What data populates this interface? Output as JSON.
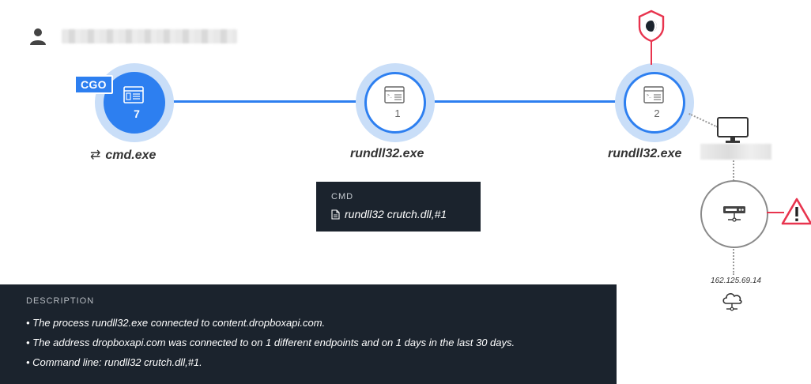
{
  "user": {
    "icon": "user-icon",
    "name_blurred": true
  },
  "nodes": [
    {
      "id": "cmd",
      "label": "cmd.exe",
      "count": "7",
      "badge": "CGO",
      "icon": "window-icon",
      "active": true,
      "prefix_icon": "sync-icon"
    },
    {
      "id": "rundll1",
      "label": "rundll32.exe",
      "count": "1",
      "icon": "window-icon",
      "active": false
    },
    {
      "id": "rundll2",
      "label": "rundll32.exe",
      "count": "2",
      "icon": "window-icon",
      "active": false
    }
  ],
  "cmd_tooltip": {
    "title": "CMD",
    "value": "rundll32 crutch.dll,#1",
    "icon": "file-icon"
  },
  "description": {
    "title": "DESCRIPTION",
    "items": [
      "• The process rundll32.exe connected to content.dropboxapi.com.",
      "• The address dropboxapi.com was connected to on 1 different endpoints and on 1 days in the last 30 days.",
      "• Command line: rundll32 crutch.dll,#1."
    ]
  },
  "network": {
    "ip": "162.125.69.14",
    "host_blurred": true,
    "icons": [
      "monitor-icon",
      "router-icon",
      "cloud-icon",
      "warning-icon",
      "shield-icon"
    ]
  },
  "colors": {
    "accent": "#2d7ff0",
    "halo": "#c9def8",
    "alert": "#e8344e",
    "panel": "#1b232d"
  }
}
